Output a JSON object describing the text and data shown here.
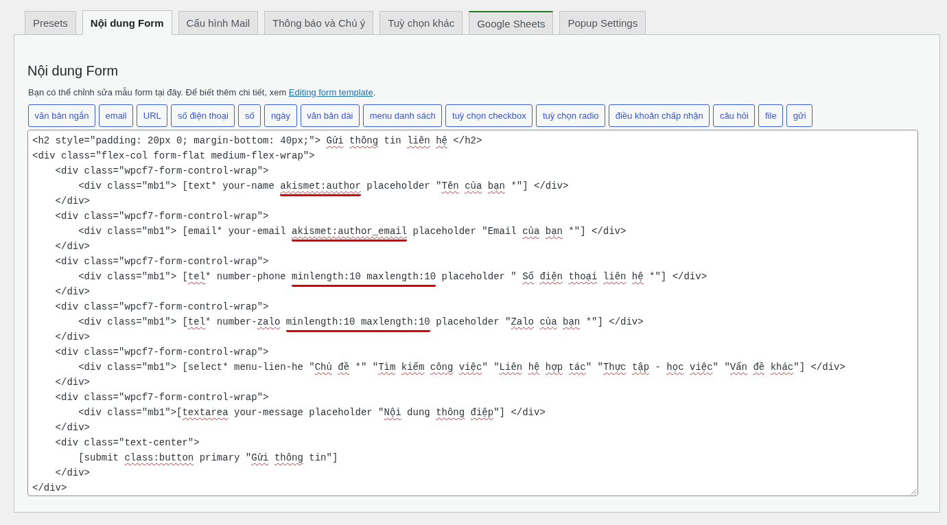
{
  "tabs": [
    {
      "label": "Presets",
      "selected": false
    },
    {
      "label": "Nội dung Form",
      "selected": true
    },
    {
      "label": "Cấu hình Mail",
      "selected": false
    },
    {
      "label": "Thông báo và Chú ý",
      "selected": false
    },
    {
      "label": "Tuỳ chọn khác",
      "selected": false
    },
    {
      "label": "Google Sheets",
      "selected": false,
      "color": "#1e7b1e"
    },
    {
      "label": "Popup Settings",
      "selected": false
    }
  ],
  "panel": {
    "title": "Nội dung Form",
    "description": {
      "text_before": "Bạn có thể chỉnh sửa mẫu form tại đây. Để biết thêm chi tiết, xem ",
      "link": "Editing form template",
      "text_after": "."
    },
    "tag_buttons": [
      "văn bản ngắn",
      "email",
      "URL",
      "số điện thoại",
      "số",
      "ngày",
      "văn bản dài",
      "menu danh sách",
      "tuỳ chọn checkbox",
      "tuỳ chọn radio",
      "điều khoản chấp nhận",
      "câu hỏi",
      "file",
      "gửi"
    ],
    "editor": {
      "lines": [
        {
          "segments": [
            {
              "text": "<h2 style=\"padding: 20px 0; margin-bottom: 40px;\"> ",
              "misspelled": false,
              "marked": false
            },
            {
              "text": "Gửi ",
              "misspelled": true,
              "marked": false
            },
            {
              "text": "thông",
              "misspelled": true,
              "marked": false
            },
            {
              "text": " tin ",
              "misspelled": false,
              "marked": false
            },
            {
              "text": "liên ",
              "misspelled": true,
              "marked": false
            },
            {
              "text": "hệ",
              "misspelled": true,
              "marked": false
            },
            {
              "text": " </h2>",
              "misspelled": false,
              "marked": false
            }
          ]
        },
        {
          "segments": [
            {
              "text": "<div class=\"flex-col form-flat medium-flex-wrap\">",
              "misspelled": false,
              "marked": false
            }
          ]
        },
        {
          "segments": [
            {
              "text": "    <div class=\"wpcf7-form-control-wrap\">",
              "misspelled": false,
              "marked": false
            }
          ]
        },
        {
          "segments": [
            {
              "text": "        <div class=\"mb1\"> [text* your-name ",
              "misspelled": false,
              "marked": false
            },
            {
              "text": "akismet:author",
              "misspelled": true,
              "marked": true
            },
            {
              "text": " placeholder \"",
              "misspelled": false,
              "marked": false
            },
            {
              "text": "Tên ",
              "misspelled": true,
              "marked": false
            },
            {
              "text": "của ",
              "misspelled": true,
              "marked": false
            },
            {
              "text": "bạn",
              "misspelled": true,
              "marked": false
            },
            {
              "text": " *\"] </div>",
              "misspelled": false,
              "marked": false
            }
          ]
        },
        {
          "segments": [
            {
              "text": "    </div>",
              "misspelled": false,
              "marked": false
            }
          ]
        },
        {
          "segments": [
            {
              "text": "    <div class=\"wpcf7-form-control-wrap\">",
              "misspelled": false,
              "marked": false
            }
          ]
        },
        {
          "segments": [
            {
              "text": "        <div class=\"mb1\"> [email* your-email ",
              "misspelled": false,
              "marked": false
            },
            {
              "text": "akismet:author_email",
              "misspelled": true,
              "marked": true
            },
            {
              "text": " placeholder \"Email ",
              "misspelled": false,
              "marked": false
            },
            {
              "text": "của ",
              "misspelled": true,
              "marked": false
            },
            {
              "text": "bạn",
              "misspelled": true,
              "marked": false
            },
            {
              "text": " *\"] </div>",
              "misspelled": false,
              "marked": false
            }
          ]
        },
        {
          "segments": [
            {
              "text": "    </div>",
              "misspelled": false,
              "marked": false
            }
          ]
        },
        {
          "segments": [
            {
              "text": "    <div class=\"wpcf7-form-control-wrap\">",
              "misspelled": false,
              "marked": false
            }
          ]
        },
        {
          "segments": [
            {
              "text": "        <div class=\"mb1\"> [",
              "misspelled": false,
              "marked": false
            },
            {
              "text": "tel",
              "misspelled": true,
              "marked": false
            },
            {
              "text": "* number-phone ",
              "misspelled": false,
              "marked": false
            },
            {
              "text": "minlength:10 maxlength:10",
              "misspelled": false,
              "marked": true
            },
            {
              "text": " placeholder \" ",
              "misspelled": false,
              "marked": false
            },
            {
              "text": "Số ",
              "misspelled": true,
              "marked": false
            },
            {
              "text": "điện ",
              "misspelled": true,
              "marked": false
            },
            {
              "text": "thoại ",
              "misspelled": true,
              "marked": false
            },
            {
              "text": "liên ",
              "misspelled": true,
              "marked": false
            },
            {
              "text": "hệ",
              "misspelled": true,
              "marked": false
            },
            {
              "text": " *\"] </div>",
              "misspelled": false,
              "marked": false
            }
          ]
        },
        {
          "segments": [
            {
              "text": "    </div>",
              "misspelled": false,
              "marked": false
            }
          ]
        },
        {
          "segments": [
            {
              "text": "    <div class=\"wpcf7-form-control-wrap\">",
              "misspelled": false,
              "marked": false
            }
          ]
        },
        {
          "segments": [
            {
              "text": "        <div class=\"mb1\"> [",
              "misspelled": false,
              "marked": false
            },
            {
              "text": "tel",
              "misspelled": true,
              "marked": false
            },
            {
              "text": "* number-",
              "misspelled": false,
              "marked": false
            },
            {
              "text": "zalo ",
              "misspelled": true,
              "marked": false
            },
            {
              "text": "minlength:10 maxlength:10",
              "misspelled": false,
              "marked": true
            },
            {
              "text": " placeholder \"",
              "misspelled": false,
              "marked": false
            },
            {
              "text": "Zalo ",
              "misspelled": true,
              "marked": false
            },
            {
              "text": "của ",
              "misspelled": true,
              "marked": false
            },
            {
              "text": "bạn",
              "misspelled": true,
              "marked": false
            },
            {
              "text": " *\"] </div>",
              "misspelled": false,
              "marked": false
            }
          ]
        },
        {
          "segments": [
            {
              "text": "    </div>",
              "misspelled": false,
              "marked": false
            }
          ]
        },
        {
          "segments": [
            {
              "text": "    <div class=\"wpcf7-form-control-wrap\">",
              "misspelled": false,
              "marked": false
            }
          ]
        },
        {
          "segments": [
            {
              "text": "        <div class=\"mb1\"> [select* menu-lien-he \"",
              "misspelled": false,
              "marked": false
            },
            {
              "text": "Chủ ",
              "misspelled": true,
              "marked": false
            },
            {
              "text": "đề",
              "misspelled": true,
              "marked": false
            },
            {
              "text": " *\" \"",
              "misspelled": false,
              "marked": false
            },
            {
              "text": "Tìm ",
              "misspelled": true,
              "marked": false
            },
            {
              "text": "kiếm ",
              "misspelled": true,
              "marked": false
            },
            {
              "text": "công ",
              "misspelled": true,
              "marked": false
            },
            {
              "text": "việc",
              "misspelled": true,
              "marked": false
            },
            {
              "text": "\" \"",
              "misspelled": false,
              "marked": false
            },
            {
              "text": "Liên ",
              "misspelled": true,
              "marked": false
            },
            {
              "text": "hệ ",
              "misspelled": true,
              "marked": false
            },
            {
              "text": "hợp ",
              "misspelled": true,
              "marked": false
            },
            {
              "text": "tác",
              "misspelled": true,
              "marked": false
            },
            {
              "text": "\" \"",
              "misspelled": false,
              "marked": false
            },
            {
              "text": "Thực ",
              "misspelled": true,
              "marked": false
            },
            {
              "text": "tập",
              "misspelled": true,
              "marked": false
            },
            {
              "text": " - ",
              "misspelled": false,
              "marked": false
            },
            {
              "text": "học ",
              "misspelled": true,
              "marked": false
            },
            {
              "text": "việc",
              "misspelled": true,
              "marked": false
            },
            {
              "text": "\" \"",
              "misspelled": false,
              "marked": false
            },
            {
              "text": "Vấn ",
              "misspelled": true,
              "marked": false
            },
            {
              "text": "đề ",
              "misspelled": true,
              "marked": false
            },
            {
              "text": "khác",
              "misspelled": true,
              "marked": false
            },
            {
              "text": "\"] </div>",
              "misspelled": false,
              "marked": false
            }
          ]
        },
        {
          "segments": [
            {
              "text": "    </div>",
              "misspelled": false,
              "marked": false
            }
          ]
        },
        {
          "segments": [
            {
              "text": "    <div class=\"wpcf7-form-control-wrap\">",
              "misspelled": false,
              "marked": false
            }
          ]
        },
        {
          "segments": [
            {
              "text": "        <div class=\"mb1\">[",
              "misspelled": false,
              "marked": false
            },
            {
              "text": "textarea",
              "misspelled": true,
              "marked": false
            },
            {
              "text": " your-message placeholder \"",
              "misspelled": false,
              "marked": false
            },
            {
              "text": "Nội",
              "misspelled": true,
              "marked": false
            },
            {
              "text": " dung ",
              "misspelled": false,
              "marked": false
            },
            {
              "text": "thông ",
              "misspelled": true,
              "marked": false
            },
            {
              "text": "điệp",
              "misspelled": true,
              "marked": false
            },
            {
              "text": "\"] </div>",
              "misspelled": false,
              "marked": false
            }
          ]
        },
        {
          "segments": [
            {
              "text": "    </div>",
              "misspelled": false,
              "marked": false
            }
          ]
        },
        {
          "segments": [
            {
              "text": "    <div class=\"text-center\">",
              "misspelled": false,
              "marked": false
            }
          ]
        },
        {
          "segments": [
            {
              "text": "        [submit ",
              "misspelled": false,
              "marked": false
            },
            {
              "text": "class:button",
              "misspelled": true,
              "marked": false
            },
            {
              "text": " primary \"",
              "misspelled": false,
              "marked": false
            },
            {
              "text": "Gửi ",
              "misspelled": true,
              "marked": false
            },
            {
              "text": "thông",
              "misspelled": true,
              "marked": false
            },
            {
              "text": " tin\"]",
              "misspelled": false,
              "marked": false
            }
          ]
        },
        {
          "segments": [
            {
              "text": "    </div>",
              "misspelled": false,
              "marked": false
            }
          ]
        },
        {
          "segments": [
            {
              "text": "</div>",
              "misspelled": false,
              "marked": false
            }
          ]
        }
      ]
    }
  }
}
